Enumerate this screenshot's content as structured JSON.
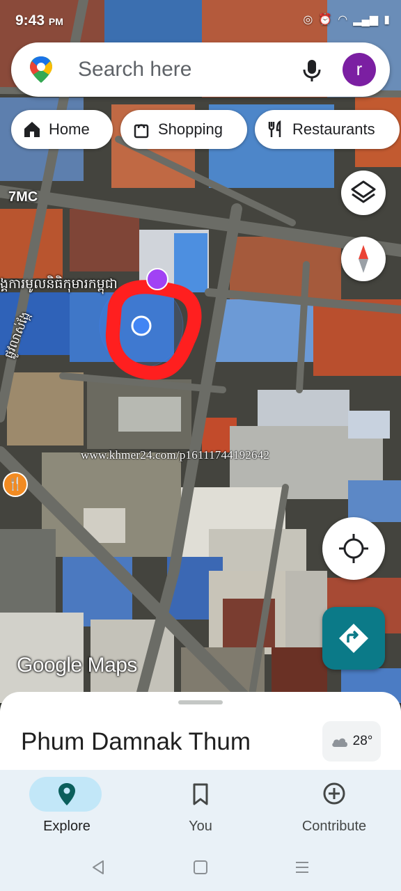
{
  "status_bar": {
    "time": "9:43",
    "meridiem": "PM"
  },
  "search": {
    "placeholder": "Search here",
    "avatar_letter": "r",
    "avatar_color": "#7b1fa2"
  },
  "chips": [
    {
      "label": "Home",
      "icon": "home-icon"
    },
    {
      "label": "Shopping",
      "icon": "shopping-bag-icon"
    },
    {
      "label": "Restaurants",
      "icon": "fork-knife-icon"
    }
  ],
  "map": {
    "road_label": "7MC",
    "khmer_label_1": "ង្គការមូលនិធិកុមារកម្ពុជា",
    "khmer_label_2": "ផ្លូវលាស់ង្កែ",
    "watermark": "www.khmer24.com/p16111744192642",
    "logo_text": "Google Maps",
    "accent_color": "#0b7a88"
  },
  "sheet": {
    "place_name": "Phum Damnak Thum",
    "temperature": "28°"
  },
  "bottom_nav": [
    {
      "label": "Explore",
      "icon": "explore-pin-icon",
      "active": true
    },
    {
      "label": "You",
      "icon": "bookmark-icon",
      "active": false
    },
    {
      "label": "Contribute",
      "icon": "add-circle-icon",
      "active": false
    }
  ]
}
